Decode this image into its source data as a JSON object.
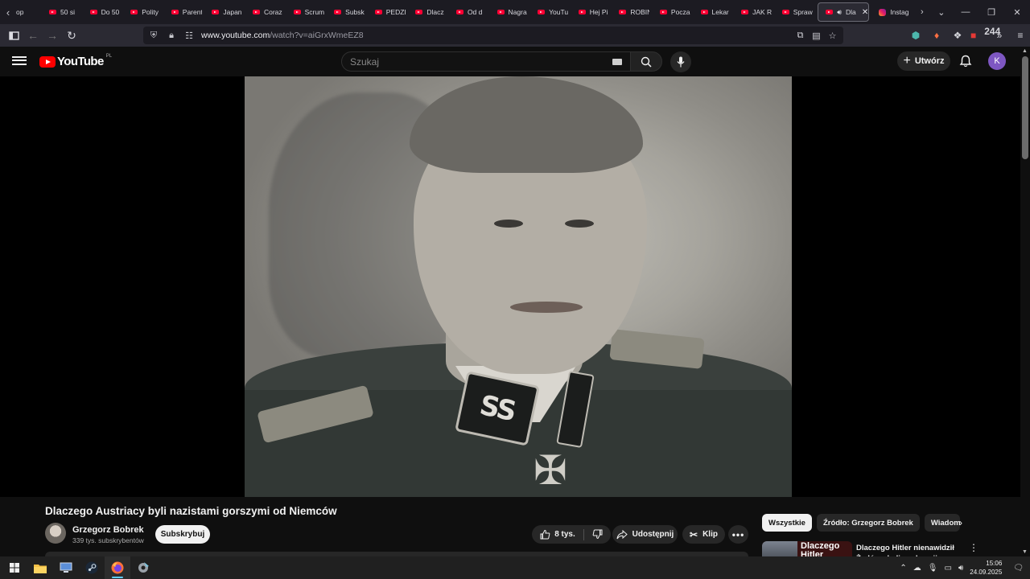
{
  "browser": {
    "tabs": [
      {
        "label": "op",
        "icon": "youtube-favicon"
      },
      {
        "label": "50 si",
        "icon": "youtube-favicon"
      },
      {
        "label": "Do 50",
        "icon": "youtube-favicon"
      },
      {
        "label": "Polity",
        "icon": "youtube-favicon"
      },
      {
        "label": "Parent",
        "icon": "youtube-favicon"
      },
      {
        "label": "Japan",
        "icon": "youtube-favicon"
      },
      {
        "label": "Coraz",
        "icon": "youtube-favicon"
      },
      {
        "label": "Scrum",
        "icon": "youtube-favicon"
      },
      {
        "label": "Subsk",
        "icon": "youtube-favicon"
      },
      {
        "label": "PEDZI",
        "icon": "youtube-favicon"
      },
      {
        "label": "Dlacz",
        "icon": "youtube-favicon"
      },
      {
        "label": "Od d",
        "icon": "youtube-favicon"
      },
      {
        "label": "Nagra",
        "icon": "youtube-favicon"
      },
      {
        "label": "YouTu",
        "icon": "youtube-favicon"
      },
      {
        "label": "Hej Pi",
        "icon": "youtube-favicon"
      },
      {
        "label": "ROBIN",
        "icon": "youtube-favicon"
      },
      {
        "label": "Pocza",
        "icon": "youtube-favicon"
      },
      {
        "label": "Lekar",
        "icon": "youtube-favicon"
      },
      {
        "label": "JAK R",
        "icon": "youtube-favicon"
      },
      {
        "label": "Spraw",
        "icon": "youtube-favicon"
      }
    ],
    "active_tab": {
      "label": "Dla",
      "icon": "youtube-favicon"
    },
    "after_tab": {
      "label": "Instag",
      "icon": "instagram-favicon"
    },
    "url_host": "www.youtube.com",
    "url_path": "/watch?v=aiGrxWmeEZ8",
    "badge_count": "244"
  },
  "youtube": {
    "logo_text": "YouTube",
    "country_code": "PL",
    "search_placeholder": "Szukaj",
    "create_label": "Utwórz",
    "avatar_letter": "K"
  },
  "video": {
    "title": "Dlaczego Austriacy byli nazistami gorszymi od Niemców",
    "channel_name": "Grzegorz Bobrek",
    "subscribers": "339 tys. subskrybentów",
    "subscribe_label": "Subskrybuj",
    "likes": "8 tys.",
    "share_label": "Udostępnij",
    "clip_label": "Klip",
    "frame_insignia": "SS"
  },
  "sidebar": {
    "chips": [
      "Wszystkie",
      "Źródło: Grzegorz Bobrek",
      "Wiadomo"
    ],
    "recommendation": {
      "thumb_text": "Dlaczego Hitler",
      "title": "Dlaczego Hitler nienawidził Żydów - kulisy obsesji"
    }
  },
  "taskbar": {
    "time": "15:06",
    "date": "24.09.2025"
  },
  "colors": {
    "youtube_red": "#ff0000",
    "background": "#0f0f0f",
    "browser_chrome": "#1c1b22",
    "avatar_purple": "#7e57c2",
    "taskbar": "#202020"
  }
}
